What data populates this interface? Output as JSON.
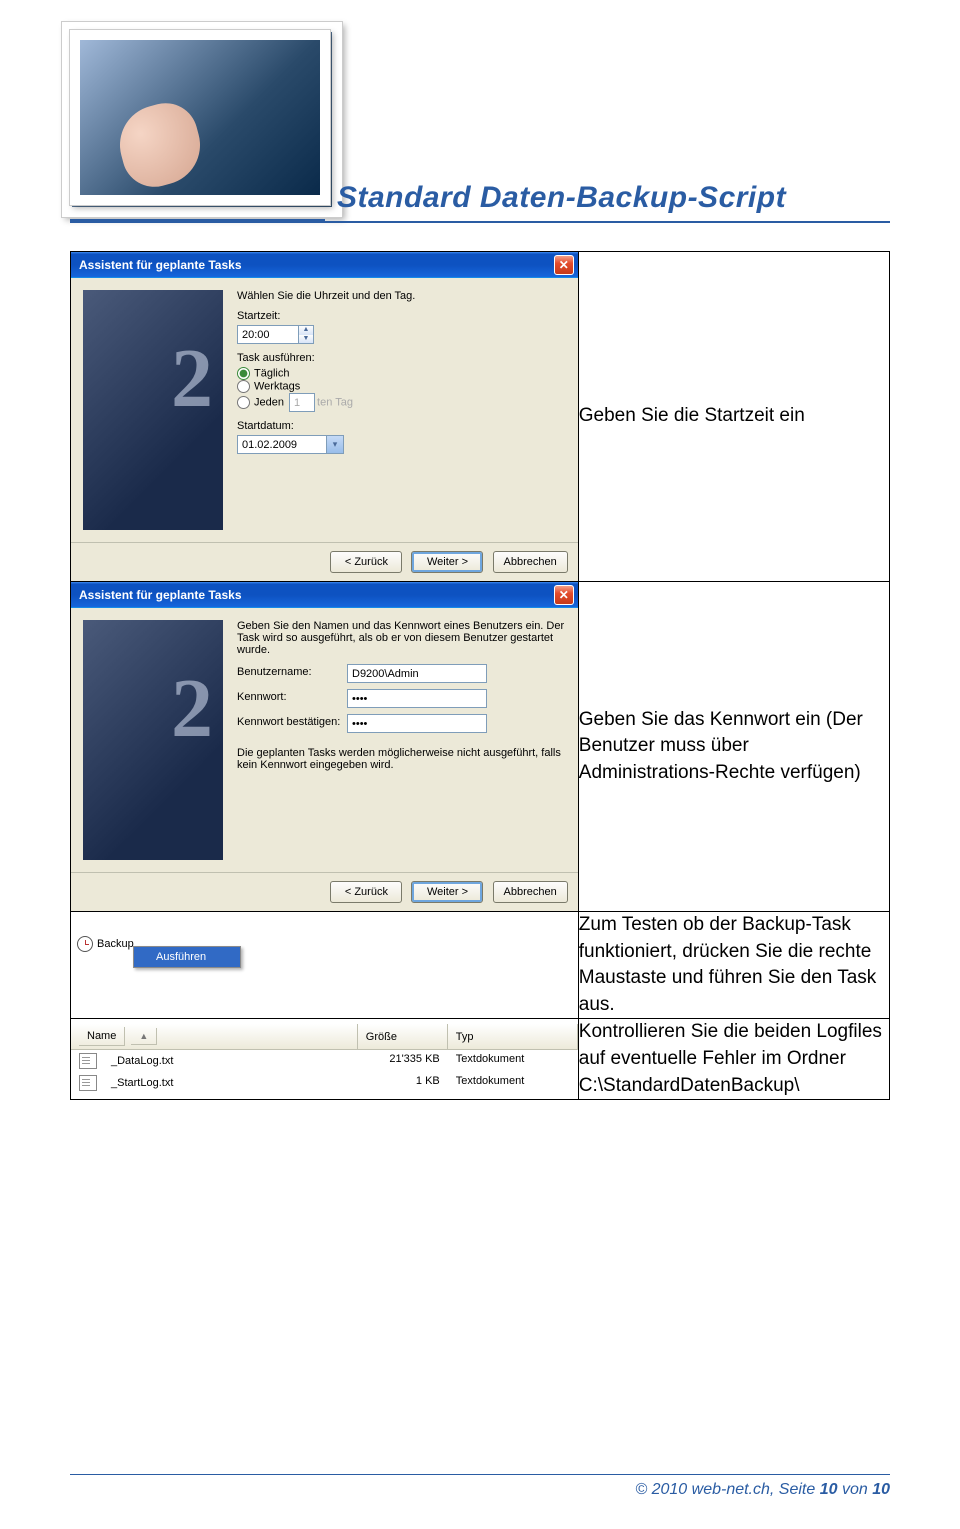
{
  "header": {
    "title": "Standard Daten-Backup-Script"
  },
  "dialog1": {
    "window_title": "Assistent für geplante Tasks",
    "prompt": "Wählen Sie die Uhrzeit und den Tag.",
    "starttime_label": "Startzeit:",
    "starttime_value": "20:00",
    "execute_label": "Task ausführen:",
    "radio_daily": "Täglich",
    "radio_weekdays": "Werktags",
    "radio_every": "Jeden",
    "every_value": "1",
    "every_suffix": "ten Tag",
    "startdate_label": "Startdatum:",
    "startdate_value": "01.02.2009",
    "btn_back": "< Zurück",
    "btn_next": "Weiter >",
    "btn_cancel": "Abbrechen"
  },
  "dialog2": {
    "window_title": "Assistent für geplante Tasks",
    "prompt": "Geben Sie den Namen und das Kennwort eines Benutzers ein. Der Task wird so ausgeführt, als ob er von diesem Benutzer gestartet wurde.",
    "user_label": "Benutzername:",
    "user_value": "D9200\\Admin",
    "pass_label": "Kennwort:",
    "pass_value": "••••",
    "pass2_label": "Kennwort bestätigen:",
    "pass2_value": "••••",
    "note": "Die geplanten Tasks werden möglicherweise nicht ausgeführt, falls kein Kennwort eingegeben wird.",
    "btn_back": "< Zurück",
    "btn_next": "Weiter >",
    "btn_cancel": "Abbrechen"
  },
  "row1_text": "Geben Sie die Startzeit ein",
  "row2_text": "Geben Sie das Kennwort ein (Der Benutzer muss über Administrations-Rechte verfügen)",
  "context_menu": {
    "task_label": "Backup",
    "menu_item": "Ausführen"
  },
  "row3_text": "Zum Testen ob der Backup-Task funktioniert, drücken Sie die rechte Maustaste und führen Sie den Task aus.",
  "filelist": {
    "col_name": "Name",
    "col_size": "Größe",
    "col_type": "Typ",
    "rows": [
      {
        "name": "_DataLog.txt",
        "size": "21'335 KB",
        "type": "Textdokument"
      },
      {
        "name": "_StartLog.txt",
        "size": "1 KB",
        "type": "Textdokument"
      }
    ]
  },
  "row4_text": "Kontrollieren Sie die beiden Logfiles auf eventuelle Fehler im Ordner C:\\StandardDatenBackup\\",
  "footer": {
    "copyright": "© 2010  web-net.ch",
    "separator": ", ",
    "page_label": "Seite ",
    "page_current": "10",
    "page_of": " von ",
    "page_total": "10"
  }
}
